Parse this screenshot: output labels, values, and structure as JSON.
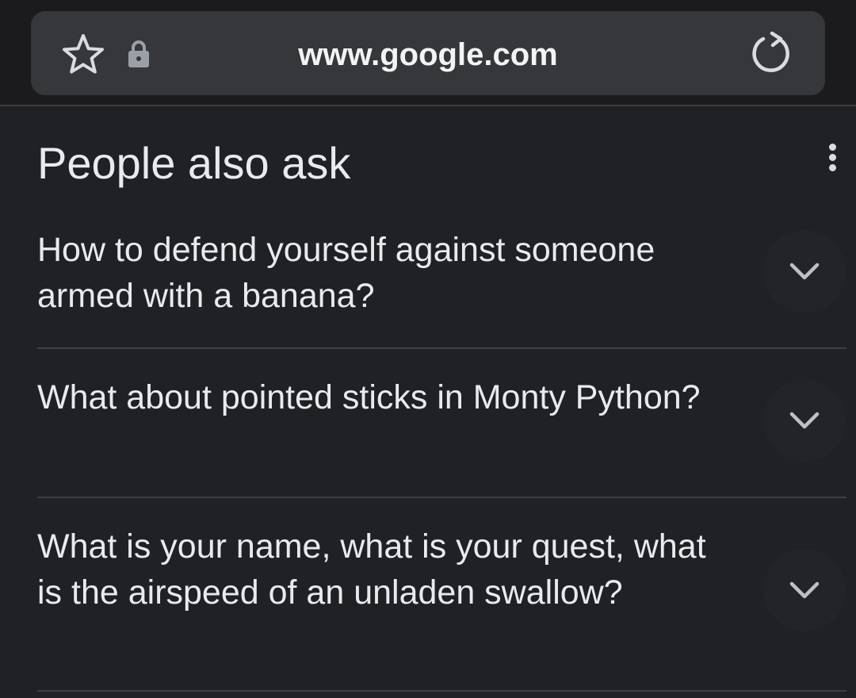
{
  "browser": {
    "url": "www.google.com",
    "icons": [
      "star-icon",
      "lock-icon",
      "reload-icon"
    ]
  },
  "people_also_ask": {
    "title": "People also ask",
    "menu_icon": "kebab-icon",
    "questions": [
      {
        "text": "How to defend yourself against someone armed with a banana?",
        "icon": "chevron-down-icon"
      },
      {
        "text": "What about pointed sticks in Monty Python?",
        "icon": "chevron-down-icon"
      },
      {
        "text": "What is your name, what is your quest, what is the airspeed of an unladen swallow?",
        "icon": "chevron-down-icon"
      }
    ]
  },
  "colors": {
    "background": "#202124",
    "toolbar": "#1b1b1d",
    "urlbar": "#36373a",
    "text": "#e8eaed",
    "divider": "#3c4043"
  }
}
